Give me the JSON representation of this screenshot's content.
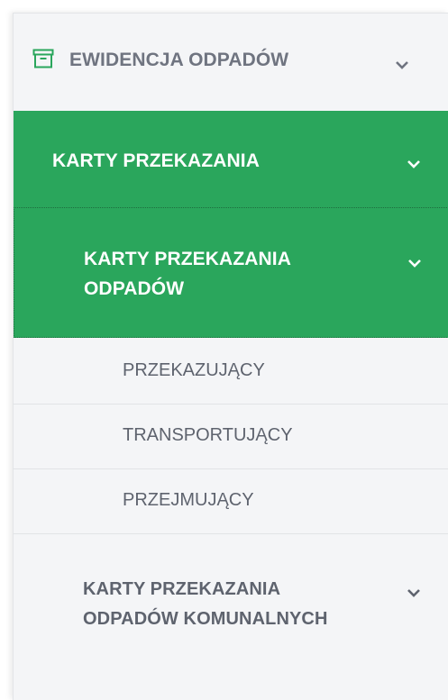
{
  "menu": {
    "section": {
      "label": "EWIDENCJA ODPADÓW",
      "icon": "archive-box-icon",
      "accent": "#2aa65c"
    },
    "level1": {
      "label": "KARTY PRZEKAZANIA",
      "active_color": "#2aa65c"
    },
    "level2": {
      "label": "KARTY PRZEKAZANIA ODPADÓW"
    },
    "subitems": [
      {
        "label": "PRZEKAZUJĄCY"
      },
      {
        "label": "TRANSPORTUJĄCY"
      },
      {
        "label": "PRZEJMUJĄCY"
      }
    ],
    "level2_other": {
      "label": "KARTY PRZEKAZANIA ODPADÓW KOMUNALNYCH"
    }
  }
}
